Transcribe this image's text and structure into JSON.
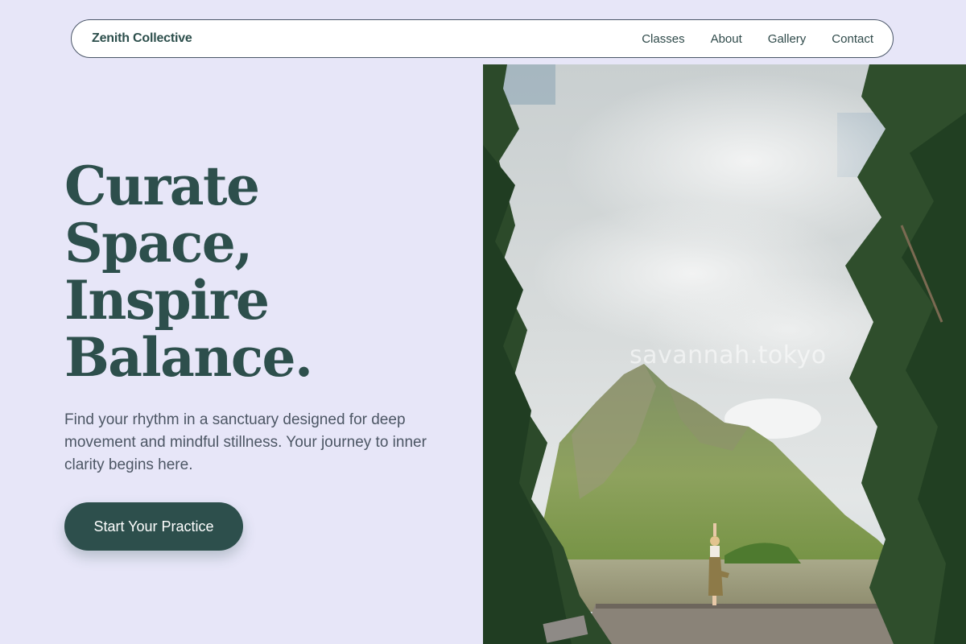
{
  "nav": {
    "brand": "Zenith Collective",
    "links": [
      {
        "label": "Classes"
      },
      {
        "label": "About"
      },
      {
        "label": "Gallery"
      },
      {
        "label": "Contact"
      }
    ]
  },
  "hero": {
    "title_lines": [
      "Curate",
      "Space,",
      "Inspire",
      "Balance."
    ],
    "subtitle": "Find your rhythm in a sanctuary designed for deep movement and mindful stillness. Your journey to inner clarity begins here.",
    "cta_label": "Start Your Practice"
  },
  "image": {
    "watermark": "savannah.tokyo",
    "description_icon": "yoga-lake-photo"
  },
  "colors": {
    "background": "#e7e6f8",
    "primary": "#2d4f4c",
    "body_text": "#4c5664",
    "nav_bg": "#ffffff"
  }
}
